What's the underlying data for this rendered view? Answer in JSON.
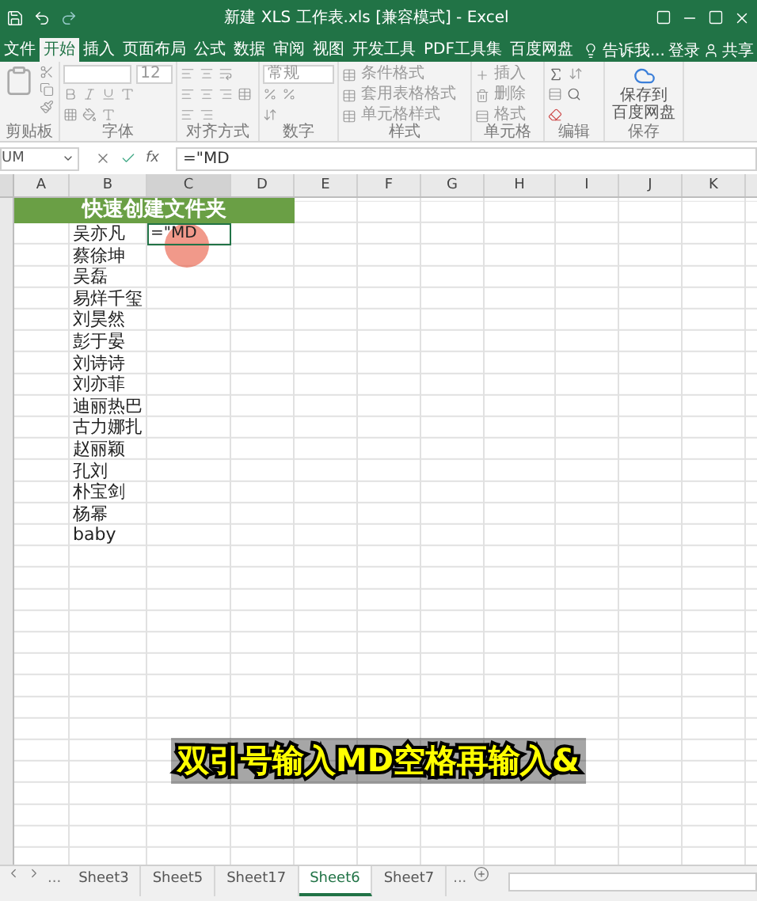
{
  "window": {
    "title": "新建 XLS 工作表.xls  [兼容模式] - Excel"
  },
  "ribbon_tabs": [
    {
      "label": "文件",
      "selected": false
    },
    {
      "label": "开始",
      "selected": true
    },
    {
      "label": "插入",
      "selected": false
    },
    {
      "label": "页面布局",
      "selected": false
    },
    {
      "label": "公式",
      "selected": false
    },
    {
      "label": "数据",
      "selected": false
    },
    {
      "label": "审阅",
      "selected": false
    },
    {
      "label": "视图",
      "selected": false
    },
    {
      "label": "开发工具",
      "selected": false
    },
    {
      "label": "PDF工具集",
      "selected": false
    },
    {
      "label": "百度网盘",
      "selected": false
    }
  ],
  "tell_me": "告诉我...",
  "sign_in": "登录",
  "share": "共享",
  "ribbon_groups": [
    {
      "kind": "clipboard",
      "label": "剪贴板"
    },
    {
      "kind": "font",
      "label": "字体",
      "font_size": "12"
    },
    {
      "kind": "align",
      "label": "对齐方式"
    },
    {
      "kind": "number",
      "label": "数字",
      "format": "常规"
    },
    {
      "kind": "styles",
      "label": "样式",
      "items": [
        "条件格式",
        "套用表格格式",
        "单元格样式"
      ]
    },
    {
      "kind": "cells",
      "label": "单元格",
      "items": [
        "插入",
        "删除",
        "格式"
      ]
    },
    {
      "kind": "editing",
      "label": "编辑"
    },
    {
      "kind": "save",
      "label": "保存",
      "lines": [
        "保存到",
        "百度网盘"
      ]
    }
  ],
  "formula_bar": {
    "name_box": "UM",
    "function_label": "fx",
    "formula": "=\"MD"
  },
  "columns": [
    "A",
    "B",
    "C",
    "D",
    "E",
    "F",
    "G",
    "H",
    "I",
    "J",
    "K"
  ],
  "sheet": {
    "heading": "快速创建文件夹",
    "names": [
      "吴亦凡",
      "蔡徐坤",
      "吴磊",
      "易烊千玺",
      "刘昊然",
      "彭于晏",
      "刘诗诗",
      "刘亦菲",
      "迪丽热巴",
      "古力娜扎",
      "赵丽颖",
      "孔刘",
      "朴宝剑",
      "杨幂",
      "baby"
    ],
    "editing_cell": {
      "value": "=\"MD"
    }
  },
  "caption": "双引号输入MD空格再输入&",
  "sheet_bar": {
    "more_left": "...",
    "tabs": [
      {
        "label": "Sheet3",
        "selected": false
      },
      {
        "label": "Sheet5",
        "selected": false
      },
      {
        "label": "Sheet17",
        "selected": false
      },
      {
        "label": "Sheet6",
        "selected": true
      },
      {
        "label": "Sheet7",
        "selected": false
      }
    ],
    "more_right": "..."
  }
}
